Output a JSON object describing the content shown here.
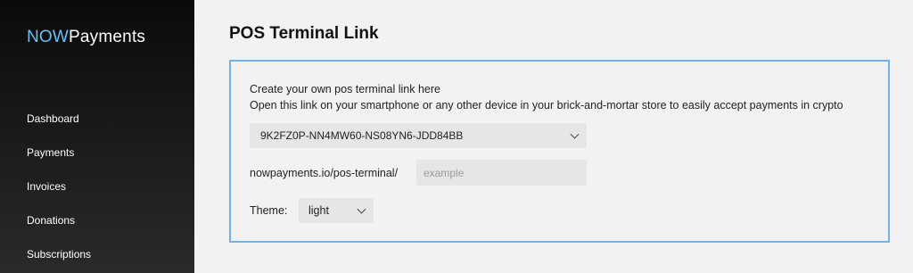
{
  "sidebar": {
    "logo": {
      "part1": "NOW",
      "part2": "Payments"
    },
    "items": [
      {
        "label": "Dashboard"
      },
      {
        "label": "Payments"
      },
      {
        "label": "Invoices"
      },
      {
        "label": "Donations"
      },
      {
        "label": "Subscriptions"
      }
    ]
  },
  "main": {
    "title": "POS Terminal Link",
    "card": {
      "line1": "Create your own pos terminal link here",
      "line2": "Open this link on your smartphone or any other device in your brick-and-mortar store to easily accept payments in crypto",
      "wallet_select": {
        "value": "9K2FZ0P-NN4MW60-NS08YN6-JDD84BB"
      },
      "url": {
        "prefix": "nowpayments.io/pos-terminal/",
        "placeholder": "example",
        "value": ""
      },
      "theme": {
        "label": "Theme:",
        "value": "light"
      }
    }
  },
  "colors": {
    "accent": "#64c2f3",
    "card_border": "#6eb2f0"
  }
}
